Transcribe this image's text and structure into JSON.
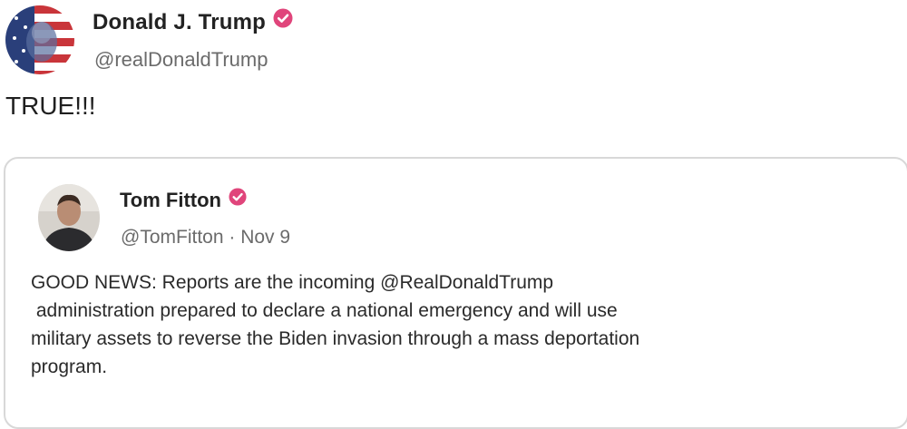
{
  "post": {
    "author": {
      "name": "Donald J. Trump",
      "handle": "@realDonaldTrump",
      "verified_color": "#e0457b"
    },
    "text": "TRUE!!!",
    "quote": {
      "author": {
        "name": "Tom Fitton",
        "handle": "@TomFitton",
        "verified_color": "#e0457b"
      },
      "separator": "·",
      "date": "Nov 9",
      "text_lines": [
        "GOOD NEWS: Reports are the incoming @RealDonaldTrump",
        " administration prepared to declare a national emergency and will use",
        "military assets to reverse the Biden invasion through a mass deportation",
        "program."
      ]
    }
  }
}
